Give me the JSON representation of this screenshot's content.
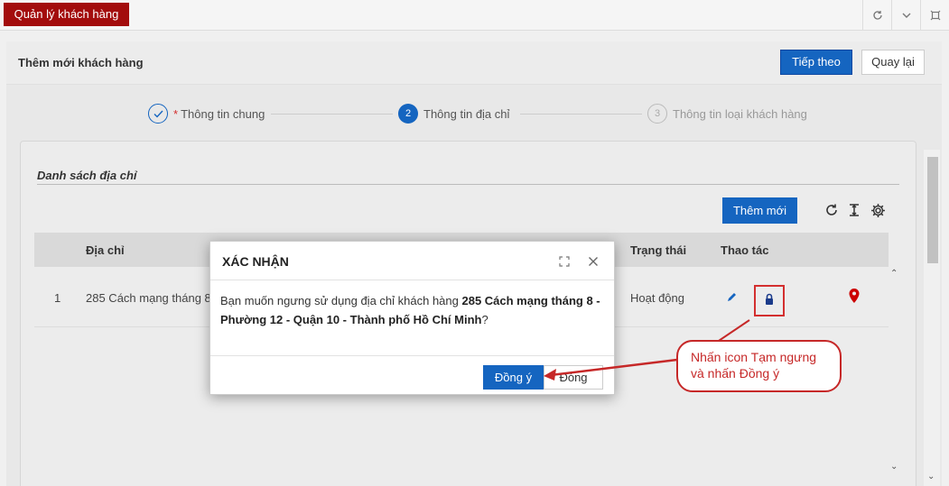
{
  "topbar": {
    "app_tab": "Quản lý khách hàng",
    "icons": [
      "refresh-icon",
      "chevron-down-icon",
      "fullscreen-icon"
    ]
  },
  "header": {
    "title": "Thêm mới khách hàng",
    "next_label": "Tiếp theo",
    "back_label": "Quay lại"
  },
  "steps": [
    {
      "number": "✓",
      "label": "Thông tin chung",
      "required_mark": "*",
      "state": "done"
    },
    {
      "number": "2",
      "label": "Thông tin địa chỉ",
      "state": "active"
    },
    {
      "number": "3",
      "label": "Thông tin loại khách hàng",
      "state": "pending"
    }
  ],
  "section": {
    "title": "Danh sách địa chỉ",
    "add_label": "Thêm mới",
    "toolbar_icons": [
      "refresh-icon",
      "column-height-icon",
      "settings-icon"
    ]
  },
  "table": {
    "columns": [
      "Địa chỉ",
      "Trạng thái",
      "Thao tác"
    ],
    "rows": [
      {
        "index": "1",
        "address": "285 Cách mạng tháng 8 -",
        "status": "Hoạt động",
        "actions": [
          "edit-icon",
          "lock-icon",
          "map-pin-icon"
        ]
      }
    ]
  },
  "dialog": {
    "title": "XÁC NHẬN",
    "message_prefix": "Bạn muốn ngưng sử dụng địa chỉ khách hàng ",
    "message_bold_1": "285 Cách mạng tháng 8 - Phường 12 - Quận 10 - Thành phố Hồ Chí Minh",
    "message_suffix": "?",
    "ok_label": "Đồng ý",
    "close_label": "Đóng"
  },
  "annotation": {
    "line1": "Nhấn icon Tạm ngưng",
    "line2": "và nhấn Đồng ý"
  },
  "colors": {
    "brand_red": "#a30d0d",
    "primary_blue": "#1565c0",
    "annotation_red": "#c62828"
  }
}
